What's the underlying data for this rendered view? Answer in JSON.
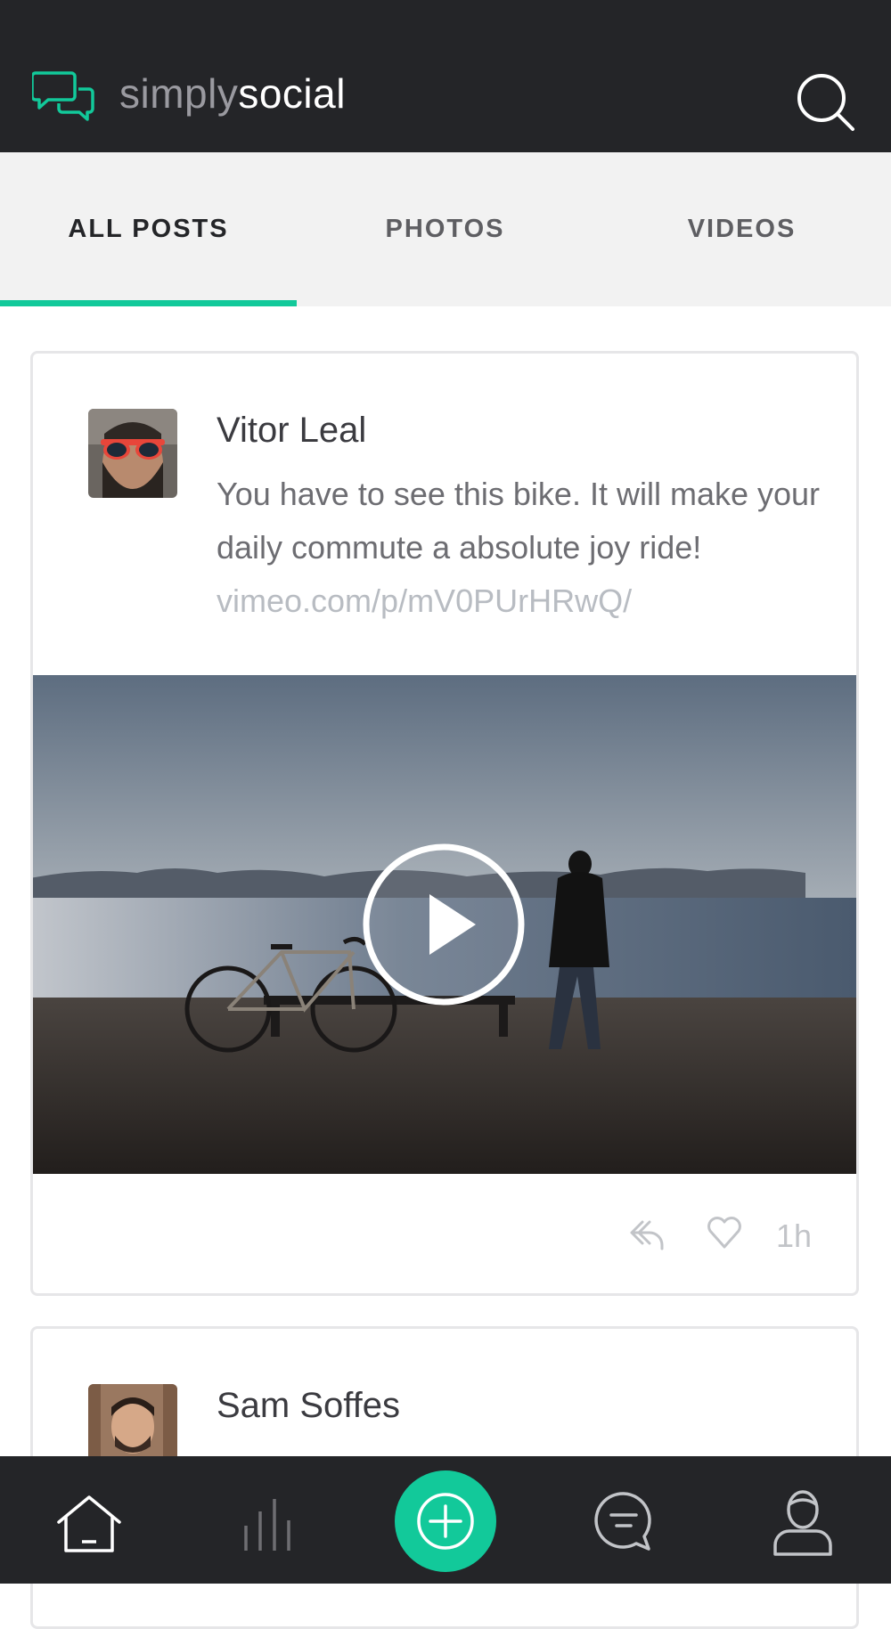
{
  "header": {
    "logo_simply": "simply",
    "logo_social": "social"
  },
  "tabs": [
    {
      "label": "ALL POSTS",
      "active": true
    },
    {
      "label": "PHOTOS",
      "active": false
    },
    {
      "label": "VIDEOS",
      "active": false
    }
  ],
  "posts": [
    {
      "author": "Vitor Leal",
      "text": "You have to see this bike. It will make your daily commute a absolute joy ride!",
      "link": "vimeo.com/p/mV0PUrHRwQ/",
      "media_type": "video",
      "time": "1h"
    },
    {
      "author": "Sam Soffes"
    }
  ],
  "bottom_nav": [
    {
      "name": "home-icon"
    },
    {
      "name": "stats-icon"
    },
    {
      "name": "add-icon"
    },
    {
      "name": "messages-icon"
    },
    {
      "name": "profile-icon"
    }
  ],
  "colors": {
    "accent": "#12c99a",
    "bar": "#242528",
    "tabs_bg": "#f2f2f2"
  }
}
